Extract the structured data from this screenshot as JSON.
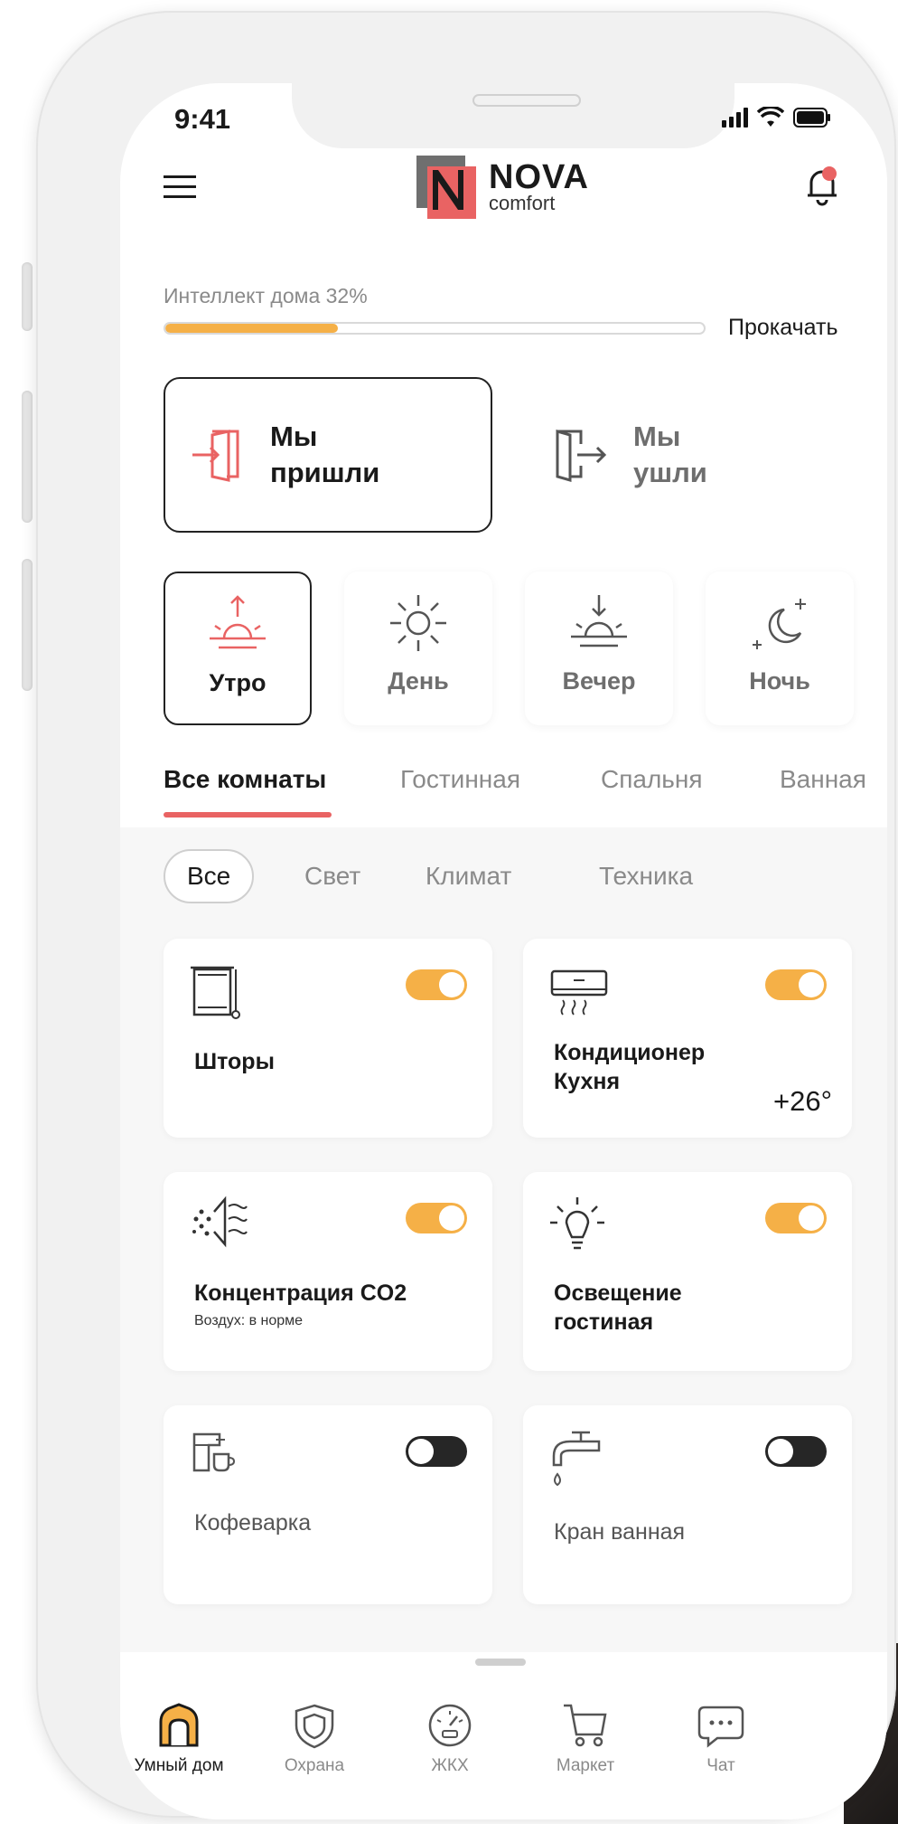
{
  "colors": {
    "accent": "#e96363",
    "toggle_on": "#f5b047",
    "toggle_off": "#262626"
  },
  "status_bar": {
    "time": "9:41"
  },
  "brand": {
    "name": "NOVA",
    "tagline": "comfort"
  },
  "progress": {
    "label": "Интеллект дома 32%",
    "percent": 32,
    "action": "Прокачать"
  },
  "scenarios": {
    "arrived": {
      "label": "Мы пришли",
      "icon": "door-enter-icon",
      "active": true
    },
    "left": {
      "label": "Мы ушли",
      "icon": "door-exit-icon",
      "active": false
    }
  },
  "times_of_day": [
    {
      "label": "Утро",
      "icon": "sunrise-icon",
      "active": true
    },
    {
      "label": "День",
      "icon": "sun-icon",
      "active": false
    },
    {
      "label": "Вечер",
      "icon": "sunset-icon",
      "active": false
    },
    {
      "label": "Ночь",
      "icon": "moon-icon",
      "active": false
    }
  ],
  "room_tabs": [
    "Все комнаты",
    "Гостинная",
    "Спальня",
    "Ванная"
  ],
  "filters": [
    "Все",
    "Свет",
    "Климат",
    "Техника"
  ],
  "devices": [
    {
      "title": "Шторы",
      "subtitle": "",
      "value": "",
      "on": true,
      "icon": "curtains-icon"
    },
    {
      "title": "Кондиционер Кухня",
      "subtitle": "",
      "value": "+26°",
      "on": true,
      "icon": "air-conditioner-icon"
    },
    {
      "title": "Концентрация CO2",
      "subtitle": "Воздух: в норме",
      "value": "",
      "on": true,
      "icon": "air-quality-icon"
    },
    {
      "title": "Освещение гостиная",
      "subtitle": "",
      "value": "",
      "on": true,
      "icon": "lightbulb-icon"
    },
    {
      "title": "Кофеварка",
      "subtitle": "",
      "value": "",
      "on": false,
      "icon": "coffee-maker-icon"
    },
    {
      "title": "Кран ванная",
      "subtitle": "",
      "value": "",
      "on": false,
      "icon": "faucet-icon"
    }
  ],
  "bottom_nav": [
    {
      "label": "Умный дом",
      "icon": "home-icon",
      "active": true
    },
    {
      "label": "Охрана",
      "icon": "shield-icon",
      "active": false
    },
    {
      "label": "ЖКХ",
      "icon": "meter-icon",
      "active": false
    },
    {
      "label": "Маркет",
      "icon": "cart-icon",
      "active": false
    },
    {
      "label": "Чат",
      "icon": "chat-icon",
      "active": false
    }
  ]
}
